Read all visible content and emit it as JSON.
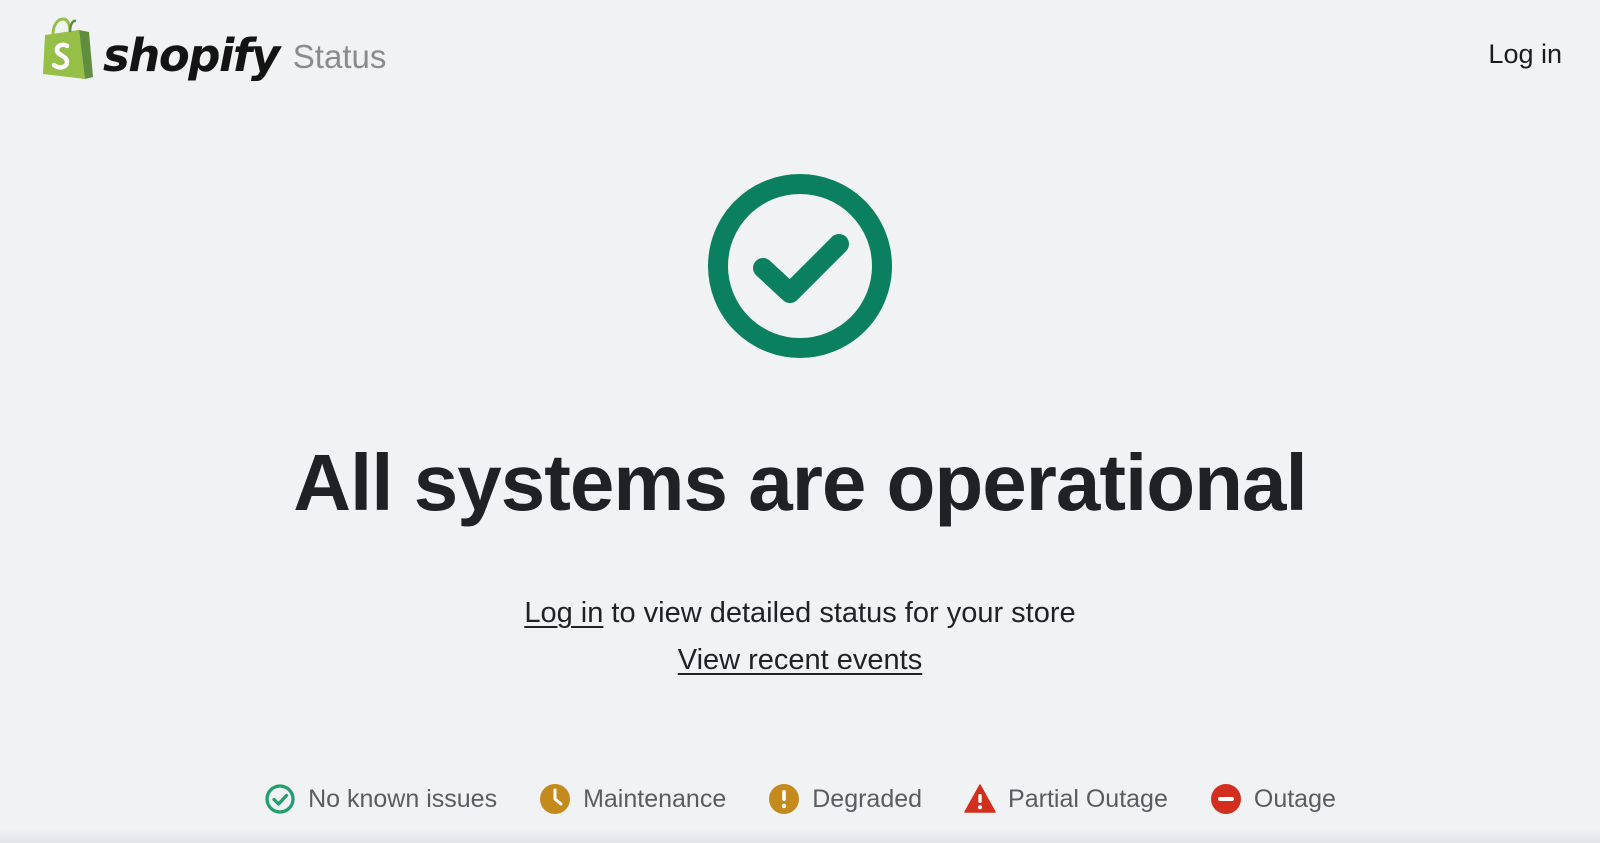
{
  "header": {
    "brand_name": "shopify",
    "brand_suffix": "Status",
    "login_label": "Log in"
  },
  "hero": {
    "icon": "check-circle-icon",
    "headline": "All systems are operational",
    "login_link": "Log in",
    "login_suffix": " to view detailed status for your store",
    "events_link": "View recent events"
  },
  "legend": {
    "items": [
      {
        "icon": "check-circle-icon",
        "label": "No known issues",
        "color": "#1e9e6a"
      },
      {
        "icon": "clock-icon",
        "label": "Maintenance",
        "color": "#c48a1c"
      },
      {
        "icon": "exclamation-circle-icon",
        "label": "Degraded",
        "color": "#c48a1c"
      },
      {
        "icon": "warning-triangle-icon",
        "label": "Partial Outage",
        "color": "#d32f1e"
      },
      {
        "icon": "minus-circle-icon",
        "label": "Outage",
        "color": "#d32f1e"
      }
    ]
  },
  "colors": {
    "background": "#f1f2f4",
    "operational_green": "#0a8060",
    "brand_green": "#95bf47",
    "text": "#1f2124"
  }
}
